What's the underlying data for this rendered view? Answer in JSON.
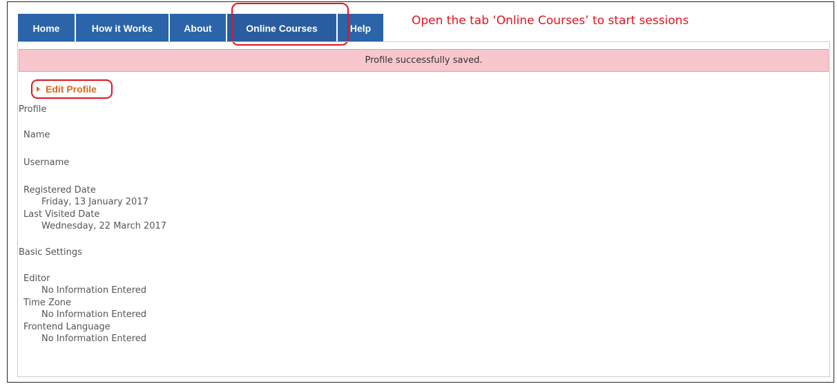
{
  "nav": {
    "tabs": [
      {
        "label": "Home"
      },
      {
        "label": "How it Works"
      },
      {
        "label": "About"
      },
      {
        "label": "Online Courses"
      },
      {
        "label": "Help"
      }
    ],
    "annotation": "Open the tab ‘Online Courses’ to start sessions"
  },
  "alert": {
    "message": "Profile successfully saved."
  },
  "edit_link": {
    "label": "Edit Profile"
  },
  "profile": {
    "heading": "Profile",
    "name_label": "Name",
    "username_label": "Username",
    "registered_label": "Registered Date",
    "registered_value": "Friday, 13 January 2017",
    "last_visited_label": "Last Visited Date",
    "last_visited_value": "Wednesday, 22 March 2017"
  },
  "basic_settings": {
    "heading": "Basic Settings",
    "editor_label": "Editor",
    "editor_value": "No Information Entered",
    "timezone_label": "Time Zone",
    "timezone_value": "No Information Entered",
    "language_label": "Frontend Language",
    "language_value": "No Information Entered"
  },
  "colors": {
    "tab_bg": "#2b64a8",
    "annotation_red": "#e0141e",
    "alert_bg": "#f8c6cd",
    "link_orange": "#d9671c"
  }
}
